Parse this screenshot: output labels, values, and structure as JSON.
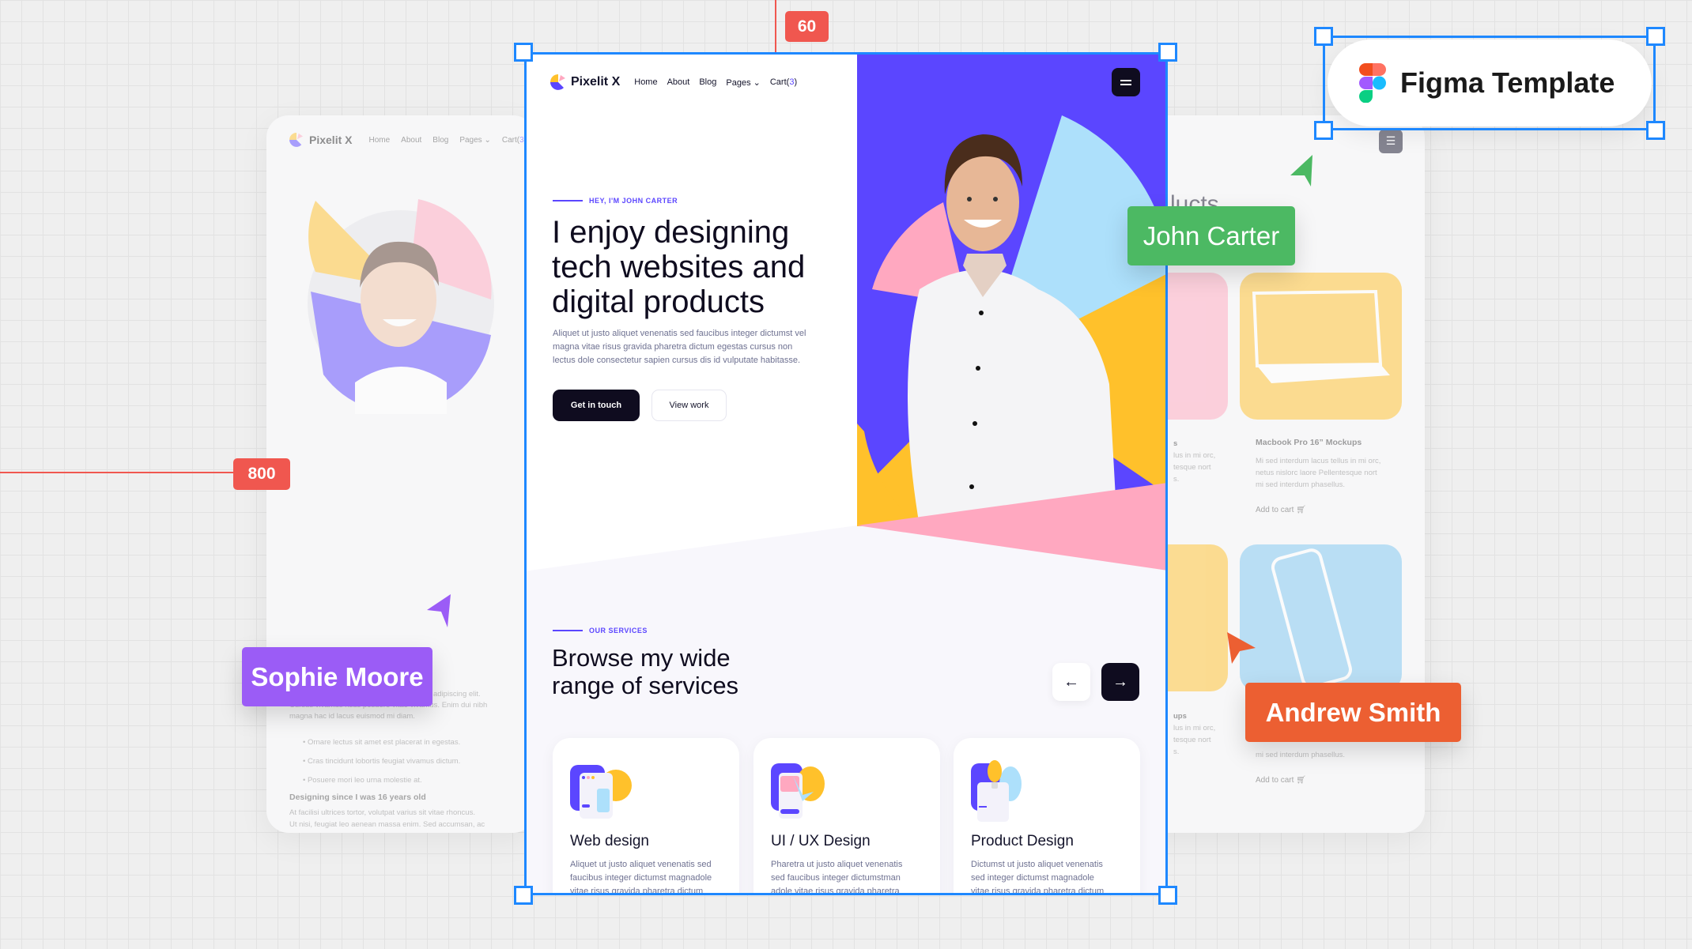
{
  "left_preview": {
    "brand": "Pixelit X",
    "nav": [
      "Home",
      "About",
      "Blog",
      "Pages",
      "Cart("
    ],
    "cart_count": "3",
    "cart_close": ")",
    "para_lines": [
      "adipiscing elit.",
      "Cursus vivamus risus posuere vitae vivamus. Enim dui nibh",
      "magna hac id lacus euismod mi diam."
    ],
    "bullets": [
      "Ornare lectus sit amet est placerat in egestas.",
      "Cras tincidunt lobortis feugiat vivamus dictum.",
      "Posuere mori leo urna molestie at."
    ],
    "subheading": "Designing since I was 16 years old",
    "para2_lines": [
      "At facilisi ultrices tortor, volutpat varius sit vitae rhoncus.",
      "Ut nisi, feugiat leo aenean massa enim. Sed accumsan, ac"
    ]
  },
  "right_preview": {
    "heading_fragment": "lucts",
    "products": [
      {
        "title": "Macbook Pro 16” Mockups",
        "desc_lines": [
          "Mi sed interdum lacus tellus in mi orc,",
          "netus nislorc laore Pellentesque nort",
          "mi sed interdum phasellus."
        ],
        "cta": "Add to cart",
        "color": "#f5d27a"
      },
      {
        "title": "",
        "desc_lines": [
          "mi sed interdum phasellus."
        ],
        "cta": "Add to cart",
        "color": "#bfe1f6"
      }
    ],
    "fragments_row1": [
      "s",
      "lus in mi orc,",
      "tesque nort",
      "s."
    ],
    "fragments_row2": [
      "ups",
      "lus in mi orc,",
      "tesque nort",
      "s."
    ]
  },
  "main": {
    "brand": "Pixelit X",
    "nav": [
      {
        "label": "Home"
      },
      {
        "label": "About"
      },
      {
        "label": "Blog"
      },
      {
        "label": "Pages"
      },
      {
        "label": "Cart("
      }
    ],
    "cart_count": "3",
    "cart_close": ")",
    "hero": {
      "eyebrow": "HEY, I'M JOHN CARTER",
      "title_lines": [
        "I enjoy designing",
        "tech websites and",
        "digital products"
      ],
      "paragraph_lines": [
        "Aliquet ut justo aliquet venenatis sed faucibus integer dictumst vel",
        "magna vitae risus gravida pharetra dictum egestas cursus non",
        "lectus dole consectetur sapien cursus dis id vulputate habitasse."
      ],
      "primary_button": "Get in touch",
      "secondary_button": "View work"
    },
    "services": {
      "eyebrow": "OUR SERVICES",
      "title_lines": [
        "Browse my wide",
        "range of services"
      ],
      "cards": [
        {
          "title": "Web design",
          "desc_lines": [
            "Aliquet ut justo aliquet venenatis sed",
            "faucibus integer dictumst magnadole",
            "vitae risus gravida pharetra dictum"
          ]
        },
        {
          "title": "UI / UX Design",
          "desc_lines": [
            "Pharetra ut justo aliquet venenatis",
            "sed faucibus integer dictumstman",
            "adole vitae risus gravida pharetra"
          ]
        },
        {
          "title": "Product Design",
          "desc_lines": [
            "Dictumst ut justo aliquet venenatis",
            "sed integer dictumst magnadole",
            "vitae risus gravida pharetra dictum"
          ]
        }
      ]
    }
  },
  "canvas": {
    "measure_top": "60",
    "measure_left": "800",
    "figma_badge": "Figma Template",
    "cursors": [
      {
        "name": "John Carter",
        "color": "#4cb963"
      },
      {
        "name": "Sophie Moore",
        "color": "#9b5cf6"
      },
      {
        "name": "Andrew Smith",
        "color": "#ec5f32"
      }
    ]
  },
  "colors": {
    "accent": "#5b46ff",
    "dark": "#0f0c1f",
    "yellow": "#ffc12b",
    "pink": "#ffa8c0",
    "lightblue": "#ade0fb",
    "selection": "#1e88ff",
    "measure": "#f0574f"
  }
}
